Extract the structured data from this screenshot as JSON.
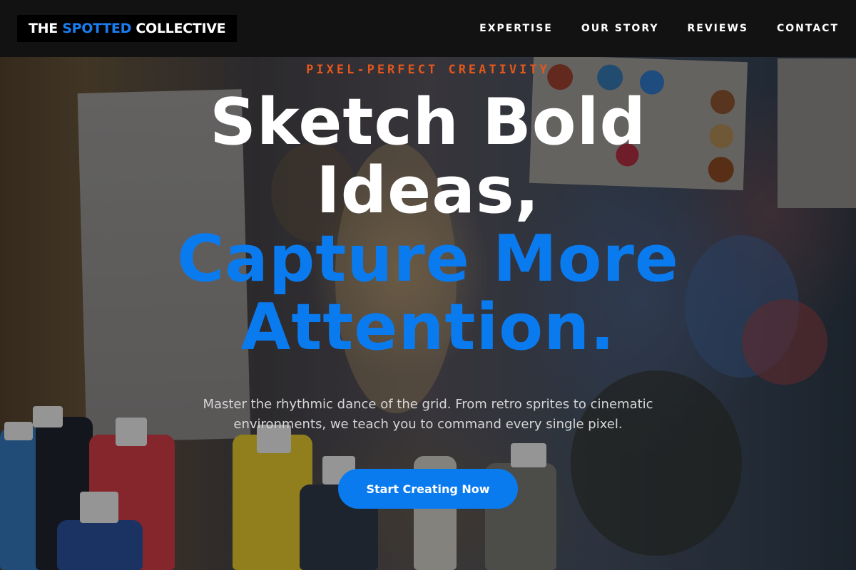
{
  "navbar": {
    "brand_prefix": "THE ",
    "brand_accent": "SPOTTED",
    "brand_suffix": " COLLECTIVE",
    "links": [
      {
        "label": "EXPERTISE"
      },
      {
        "label": "OUR STORY"
      },
      {
        "label": "REVIEWS"
      },
      {
        "label": "CONTACT"
      }
    ]
  },
  "hero": {
    "eyebrow": "PIXEL-PERFECT CREATIVITY",
    "headline_line1": "Sketch Bold",
    "headline_line2": "Ideas,",
    "headline_line3": "Capture More",
    "headline_line4": "Attention.",
    "subtitle": "Master the rhythmic dance of the grid. From retro sprites to cinematic environments, we teach you to command every single pixel.",
    "cta_label": "Start Creating Now"
  },
  "colors": {
    "accent_blue": "#0a7bef",
    "eyebrow_orange": "#e4571c",
    "navbar_bg": "#121212"
  }
}
